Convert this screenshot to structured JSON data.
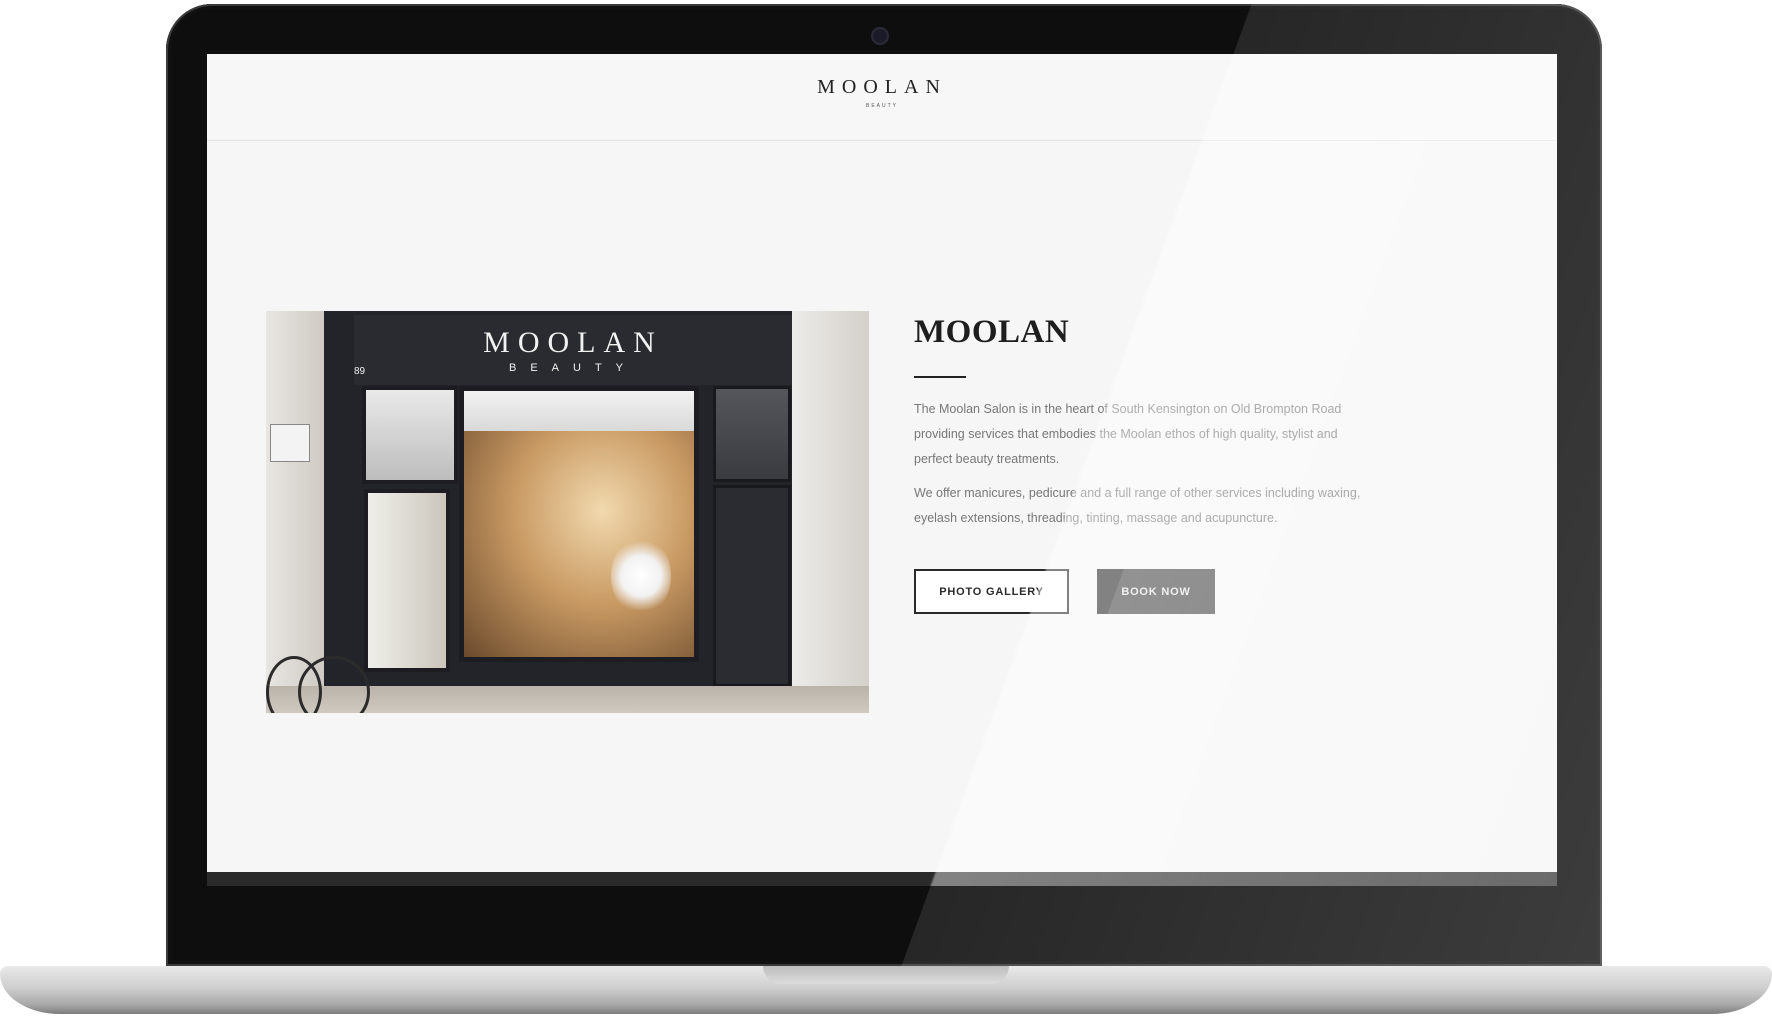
{
  "site": {
    "logo": {
      "word": "MOOLAN",
      "sub": "BEAUTY"
    }
  },
  "photo": {
    "sign_main": "MOOLAN",
    "sign_sub": "BEAUTY",
    "street_number": "89"
  },
  "about": {
    "title": "MOOLAN",
    "paragraph1": "The Moolan Salon is in the heart of South Kensington on Old Brompton Road providing services that embodies the Moolan ethos of high quality, stylist and perfect beauty treatments.",
    "paragraph2": "We offer manicures, pedicure and a full range of other services including waxing, eyelash extensions, threading, tinting, massage and acupuncture.",
    "buttons": {
      "gallery": "PHOTO GALLERY",
      "book": "BOOK NOW"
    }
  },
  "colors": {
    "page_bg": "#f6f6f6",
    "text_dark": "#1e1e1e",
    "text_body": "#777777",
    "button_dark": "#3d3d3d"
  }
}
